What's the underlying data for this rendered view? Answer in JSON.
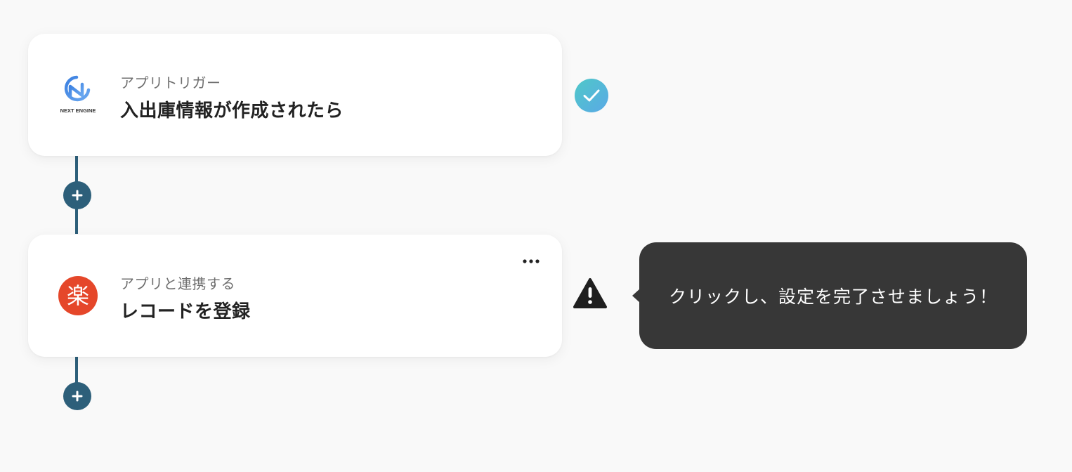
{
  "flow": {
    "steps": [
      {
        "subtitle": "アプリトリガー",
        "title": "入出庫情報が作成されたら",
        "app_logo": "next-engine-logo",
        "logo_text": "NEXT ENGINE",
        "status": "completed"
      },
      {
        "subtitle": "アプリと連携する",
        "title": "レコードを登録",
        "app_logo": "rakuten-logo",
        "logo_text": "楽",
        "status": "warning"
      }
    ],
    "tooltip": {
      "text": "クリックし、設定を完了させましょう！"
    }
  },
  "colors": {
    "connector": "#2d5f7a",
    "tooltip_bg": "#373737",
    "check_gradient_start": "#4fc8c8",
    "check_gradient_end": "#5aa9e6",
    "rakuten_red": "#e5472a",
    "next_engine_blue": "#4a8fe3"
  },
  "icons": {
    "add": "plus-icon",
    "more": "more-horizontal-icon",
    "completed": "check-circle-icon",
    "warning": "warning-triangle-icon"
  }
}
